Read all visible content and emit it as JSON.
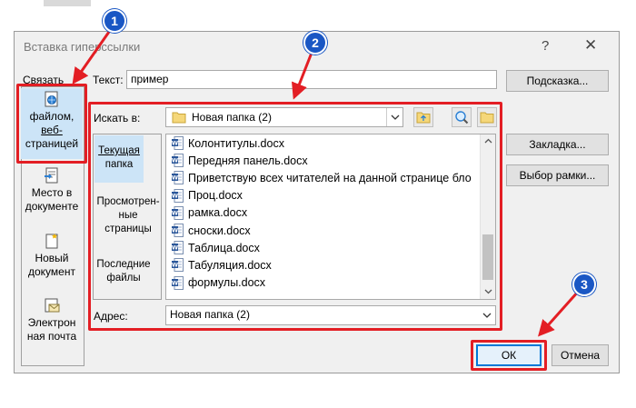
{
  "dialog": {
    "title": "Вставка гиперссылки",
    "help_glyph": "?",
    "close_glyph": "✕"
  },
  "link_to": {
    "label": "Связать",
    "items": [
      {
        "label_lines": [
          "файлом,",
          "веб-",
          "страницей"
        ],
        "icon": "globe-file-icon",
        "selected": true
      },
      {
        "label_lines": [
          "Место в",
          "документе"
        ],
        "icon": "document-place-icon",
        "selected": false
      },
      {
        "label_lines": [
          "Новый",
          "документ"
        ],
        "icon": "new-document-icon",
        "selected": false
      },
      {
        "label_lines": [
          "Электрон",
          "ная почта"
        ],
        "icon": "email-icon",
        "selected": false
      }
    ]
  },
  "text_field": {
    "label": "Текст:",
    "value": "пример"
  },
  "buttons": {
    "hint": "Подсказка...",
    "bookmark": "Закладка...",
    "frame": "Выбор рамки...",
    "ok": "ОК",
    "cancel": "Отмена"
  },
  "look_in": {
    "label": "Искать в:",
    "value": "Новая папка (2)"
  },
  "sub_nav": [
    {
      "label_lines": [
        "Текущая",
        "папка"
      ],
      "selected": true
    },
    {
      "label_lines": [
        "Просмотрен-",
        "ные",
        "страницы"
      ],
      "selected": false
    },
    {
      "label_lines": [
        "Последние",
        "файлы"
      ],
      "selected": false
    }
  ],
  "files": [
    "Колонтитулы.docx",
    "Передняя панель.docx",
    "Приветствую всех читателей на данной странице бло",
    "Проц.docx",
    "рамка.docx",
    "сноски.docx",
    "Таблица.docx",
    "Табуляция.docx",
    "формулы.docx"
  ],
  "address": {
    "label": "Адрес:",
    "value": "Новая папка (2)"
  },
  "markers": [
    "1",
    "2",
    "3"
  ],
  "colors": {
    "annotation_red": "#e31e24",
    "marker_blue": "#1a57c4",
    "selected_blue": "#cce4f7"
  }
}
